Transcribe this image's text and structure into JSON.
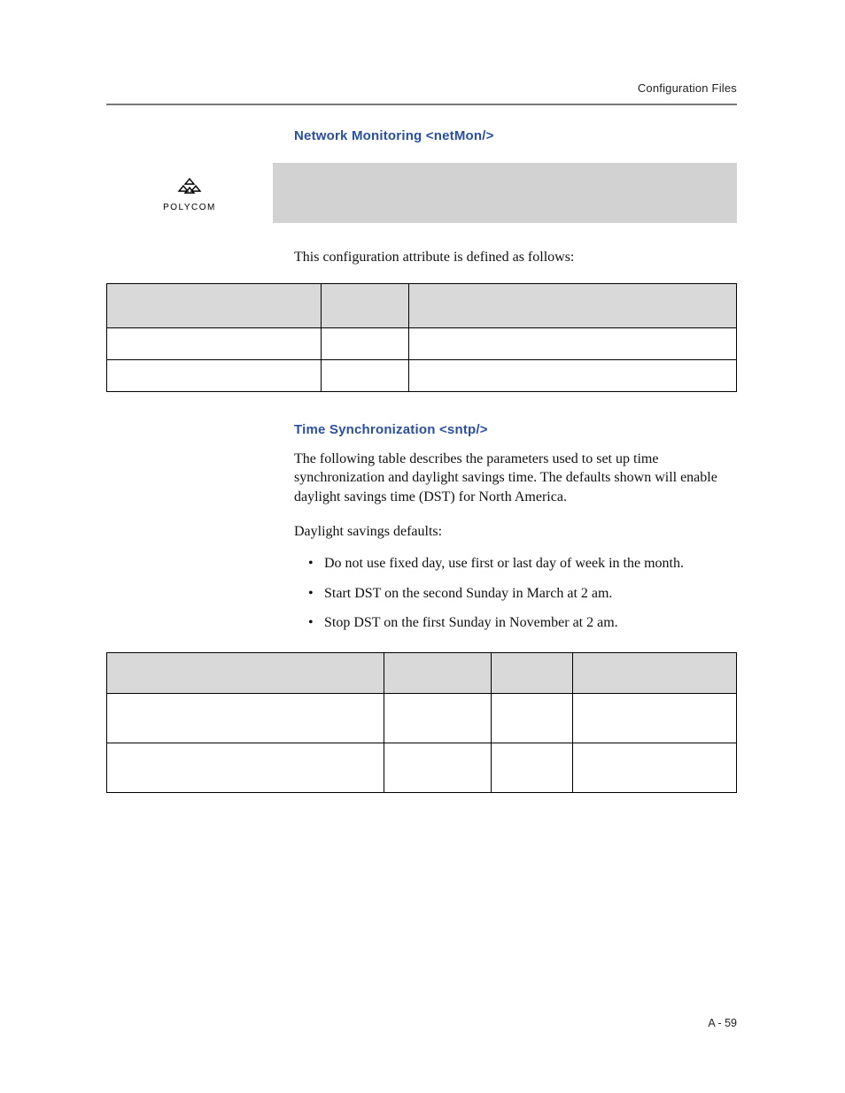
{
  "running_head": "Configuration Files",
  "section_netmon_title": "Network Monitoring <netMon/>",
  "logo_word": "POLYCOM",
  "netmon_intro": "This configuration attribute is defined as follows:",
  "table_netmon": {
    "headers": [
      "",
      "",
      ""
    ],
    "rows": [
      [
        "",
        "",
        ""
      ],
      [
        "",
        "",
        ""
      ]
    ]
  },
  "section_sntp_title": "Time Synchronization <sntp/>",
  "sntp_para": "The following table describes the parameters used to set up time synchronization and daylight savings time. The defaults shown will enable daylight savings time (DST) for North America.",
  "sntp_defaults_label": "Daylight savings defaults:",
  "dst_bullets": [
    "Do not use fixed day, use first or last day of week in the month.",
    "Start DST on the second Sunday in March at 2 am.",
    "Stop DST on the first Sunday in November at 2 am."
  ],
  "table_sntp": {
    "headers": [
      "",
      "",
      "",
      ""
    ],
    "rows": [
      [
        "",
        "",
        "",
        ""
      ],
      [
        "",
        "",
        "",
        ""
      ]
    ]
  },
  "page_number": "A - 59"
}
